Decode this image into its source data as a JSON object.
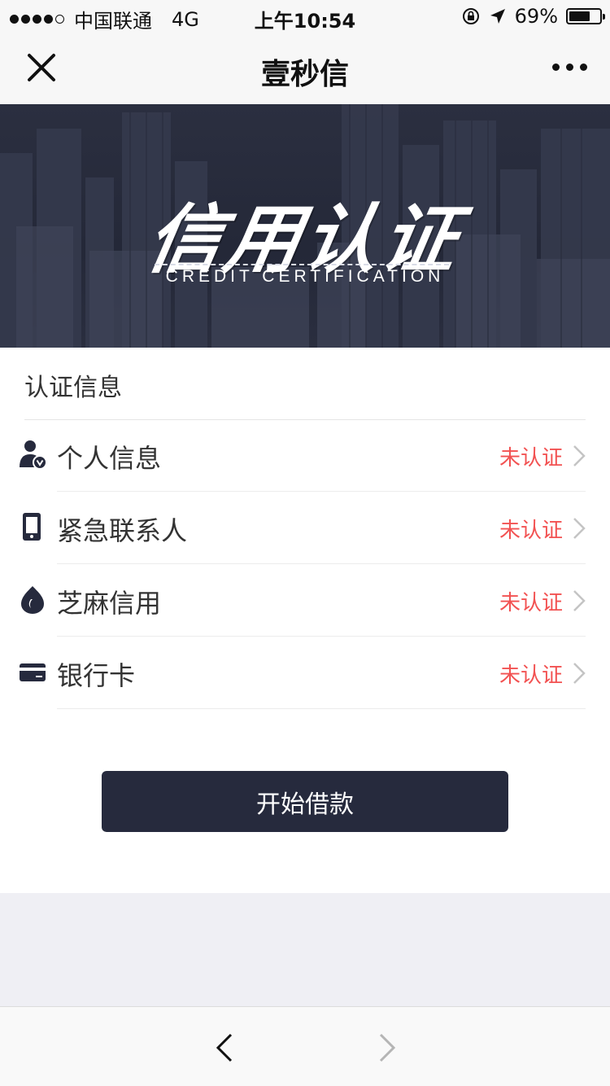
{
  "status_bar": {
    "signal_dots_filled": 4,
    "signal_dots_total": 5,
    "carrier": "中国联通",
    "network": "4G",
    "time": "上午10:54",
    "battery": "69%",
    "battery_level": 0.69
  },
  "nav": {
    "title": "壹秒信",
    "close_icon": "close-icon",
    "more_icon": "more-icon"
  },
  "banner": {
    "title": "信用认证",
    "subtitle": "CREDIT CERTIFICATION"
  },
  "section": {
    "title": "认证信息"
  },
  "items": [
    {
      "label": "个人信息",
      "status": "未认证",
      "icon": "user-verified-icon"
    },
    {
      "label": "紧急联系人",
      "status": "未认证",
      "icon": "phone-icon"
    },
    {
      "label": "芝麻信用",
      "status": "未认证",
      "icon": "sesame-credit-icon"
    },
    {
      "label": "银行卡",
      "status": "未认证",
      "icon": "bank-card-icon"
    }
  ],
  "action": {
    "label": "开始借款"
  },
  "toolbar": {
    "back_icon": "back-arrow-icon",
    "forward_icon": "forward-arrow-icon"
  },
  "colors": {
    "accent_dark": "#262a3d",
    "status_red": "#f25252",
    "banner_bg": "#2b2f40"
  }
}
